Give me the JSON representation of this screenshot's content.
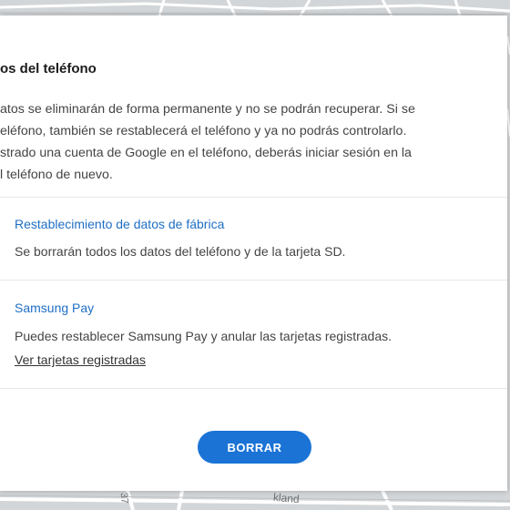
{
  "colors": {
    "accent": "#1b73d6",
    "link_blue": "#1f6fc4",
    "dialog_bg": "#ffffff",
    "text_primary": "#1a1a1a",
    "text_secondary": "#444444"
  },
  "map": {
    "street_label": "kland",
    "number_label": "37"
  },
  "dialog": {
    "title": "os del teléfono",
    "description_lines": [
      "atos se eliminarán de forma permanente y no se podrán recuperar. Si se",
      "eléfono, también se restablecerá el teléfono y ya no podrás controlarlo.",
      "strado una cuenta de Google en el teléfono, deberás iniciar sesión en la",
      "l teléfono de nuevo."
    ],
    "sections": [
      {
        "title": "Restablecimiento de datos de fábrica",
        "body": "Se borrarán todos los datos del teléfono y de la tarjeta SD."
      },
      {
        "title": "Samsung Pay",
        "body": "Puedes restablecer Samsung Pay y anular las tarjetas registradas.",
        "link": "Ver tarjetas registradas"
      }
    ],
    "primary_button": "BORRAR"
  }
}
